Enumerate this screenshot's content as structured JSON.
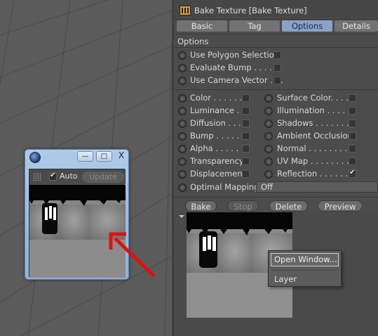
{
  "floating_window": {
    "auto_label": "Auto",
    "auto_checked": true,
    "update_label": "Update",
    "min_glyph": "—",
    "max_glyph": "□",
    "close_glyph": "X"
  },
  "attribute_manager": {
    "title": "Bake Texture [Bake Texture]",
    "tabs": [
      {
        "label": "Basic",
        "active": false
      },
      {
        "label": "Tag",
        "active": false
      },
      {
        "label": "Options",
        "active": true
      },
      {
        "label": "Details",
        "active": false
      }
    ],
    "section_title": "Options",
    "top_options": [
      {
        "label": "Use Polygon Selection",
        "checked": false
      },
      {
        "label": "Evaluate Bump . . . . . .",
        "checked": false
      },
      {
        "label": "Use Camera Vector . . .",
        "checked": false
      }
    ],
    "channels_left": [
      {
        "label": "Color . . . . . . .",
        "checked": false
      },
      {
        "label": "Luminance . . .",
        "checked": false
      },
      {
        "label": "Diffusion . . . .",
        "checked": false
      },
      {
        "label": "Bump . . . . . . .",
        "checked": false
      },
      {
        "label": "Alpha . . . . . . .",
        "checked": false
      },
      {
        "label": "Transparency",
        "checked": false
      },
      {
        "label": "Displacement",
        "checked": false
      }
    ],
    "channels_right": [
      {
        "label": "Surface Color. . . . .",
        "checked": false
      },
      {
        "label": "Illumination . . . . . .",
        "checked": false
      },
      {
        "label": "Shadows . . . . . . . .",
        "checked": false
      },
      {
        "label": "Ambient Occlusion",
        "checked": false
      },
      {
        "label": "Normal . . . . . . . . .",
        "checked": false
      },
      {
        "label": "UV Map . . . . . . . .",
        "checked": false
      },
      {
        "label": "Reflection . . . . . . .",
        "checked": true
      }
    ],
    "optimal_mapping": {
      "label": "Optimal Mapping",
      "value": "Off"
    },
    "buttons": {
      "bake": "Bake",
      "stop": "Stop",
      "delete": "Delete",
      "preview": "Preview"
    }
  },
  "context_menu": {
    "items": [
      "Open Window...",
      "Layer"
    ]
  },
  "colors": {
    "arrow": "#e01010",
    "active_tab": "#8aa2c4"
  }
}
